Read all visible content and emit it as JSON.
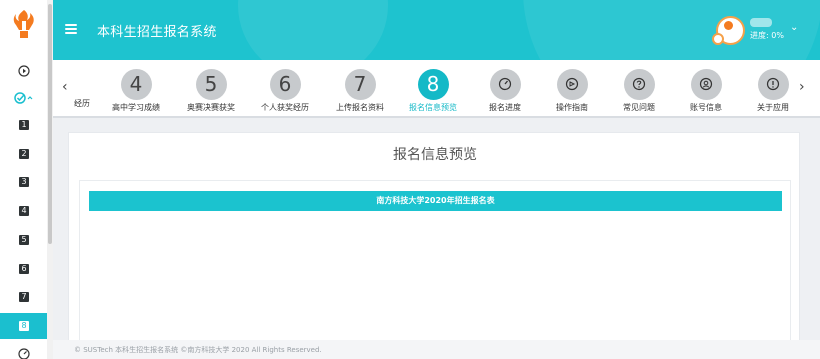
{
  "header": {
    "app_title": "本科生招生报名系统",
    "progress_text": "进度: 0%"
  },
  "sidebar": {
    "items": [
      "1",
      "2",
      "3",
      "4",
      "5",
      "6",
      "7",
      "8"
    ],
    "active_item": "8"
  },
  "steps": [
    {
      "number": "",
      "label": "经历",
      "state": "cut"
    },
    {
      "number": "4",
      "label": "高中学习成绩",
      "state": "default"
    },
    {
      "number": "5",
      "label": "奥赛决赛获奖",
      "state": "default"
    },
    {
      "number": "6",
      "label": "个人获奖经历",
      "state": "default"
    },
    {
      "number": "7",
      "label": "上传报名资料",
      "state": "default"
    },
    {
      "number": "8",
      "label": "报名信息预览",
      "state": "active"
    },
    {
      "number": "",
      "label": "报名进度",
      "icon": "gauge-icon",
      "state": "default"
    },
    {
      "number": "",
      "label": "操作指南",
      "icon": "guide-icon",
      "state": "default"
    },
    {
      "number": "",
      "label": "常见问题",
      "icon": "question-icon",
      "state": "default"
    },
    {
      "number": "",
      "label": "账号信息",
      "icon": "account-icon",
      "state": "default"
    },
    {
      "number": "",
      "label": "关于应用",
      "icon": "info-icon",
      "state": "default"
    }
  ],
  "main": {
    "page_title": "报名信息预览",
    "form_banner": "南方科技大学2020年招生报名表"
  },
  "footer": {
    "copyright": "© SUSTech 本科生招生报名系统 ©南方科技大学 2020 All Rights Reserved."
  },
  "colors": {
    "accent": "#1ec3cf",
    "active_step": "#14b9c7",
    "sidebar_active": "#1bbfcf",
    "avatar_orange": "#f47b20"
  }
}
